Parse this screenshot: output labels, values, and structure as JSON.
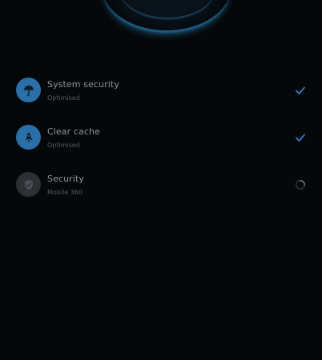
{
  "colors": {
    "background": "#060708",
    "accent": "#2a6fa8",
    "title": "#8a939c",
    "subtitle": "#555d65",
    "pending_icon_bg": "#2c2f33"
  },
  "checks": [
    {
      "icon": "umbrella-icon",
      "title": "System security",
      "subtitle": "Optimised",
      "status": "done",
      "status_icon": "checkmark-icon"
    },
    {
      "icon": "rocket-icon",
      "title": "Clear cache",
      "subtitle": "Optimised",
      "status": "done",
      "status_icon": "checkmark-icon"
    },
    {
      "icon": "shield-icon",
      "title": "Security",
      "subtitle": "Mobile 360",
      "status": "in-progress",
      "status_icon": "loading-spinner-icon"
    }
  ]
}
